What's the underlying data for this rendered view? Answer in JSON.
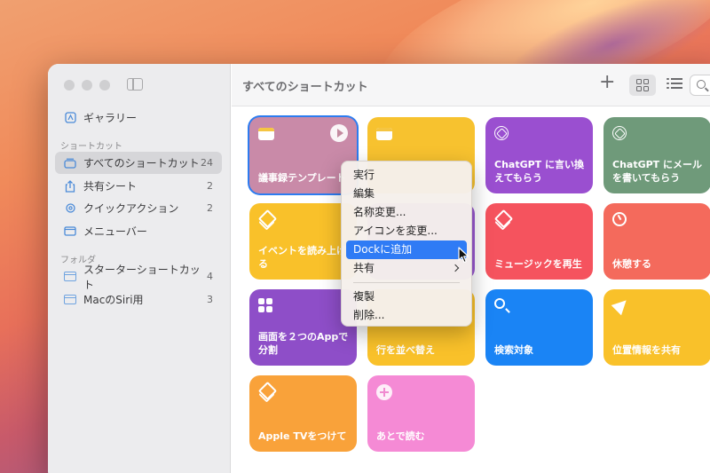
{
  "window": {
    "title": "すべてのショートカット"
  },
  "sidebar": {
    "gallery": {
      "label": "ギャラリー"
    },
    "shortcuts_section": "ショートカット",
    "items": [
      {
        "label": "すべてのショートカット",
        "count": "24",
        "icon": "stack-icon"
      },
      {
        "label": "共有シート",
        "count": "2",
        "icon": "share-icon"
      },
      {
        "label": "クイックアクション",
        "count": "2",
        "icon": "gear-icon"
      },
      {
        "label": "メニューバー",
        "count": "",
        "icon": "menubar-icon"
      }
    ],
    "folders_section": "フォルダ",
    "folders": [
      {
        "label": "スターターショートカット",
        "count": "4"
      },
      {
        "label": "MacのSiri用",
        "count": "3"
      }
    ]
  },
  "tiles": [
    {
      "name": "議事録テンプレート",
      "color": "#c98aa8",
      "icon": "note-icon"
    },
    {
      "name": "",
      "color": "#f7c22f",
      "icon": "note-icon"
    },
    {
      "name": "ChatGPT に言い換えてもらう",
      "color": "#9a4fd0",
      "icon": "openai-icon"
    },
    {
      "name": "ChatGPT にメールを書いてもらう",
      "color": "#6f9a7a",
      "icon": "openai-icon"
    },
    {
      "name": "イベントを読み上げる",
      "color": "#f9c12a",
      "icon": "layers-icon"
    },
    {
      "name": "",
      "color": "#9a5ad0",
      "icon": "layers-icon"
    },
    {
      "name": "ミュージックを再生",
      "color": "#f5535e",
      "icon": "layers-icon"
    },
    {
      "name": "休憩する",
      "color": "#f46a5c",
      "icon": "timer-icon"
    },
    {
      "name": "画面を２つのAppで分割",
      "color": "#8e4ec8",
      "icon": "grid-icon"
    },
    {
      "name": "行を並べ替え",
      "color": "#f9c12a",
      "icon": "none"
    },
    {
      "name": "検索対象",
      "color": "#1a84f5",
      "icon": "search-icon"
    },
    {
      "name": "位置情報を共有",
      "color": "#f9c12a",
      "icon": "location-icon"
    },
    {
      "name": "Apple TVをつけて",
      "color": "#f9a23a",
      "icon": "layers-icon"
    },
    {
      "name": "あとで読む",
      "color": "#f58ad5",
      "icon": "plus-icon"
    }
  ],
  "context_menu": {
    "items": [
      "実行",
      "編集",
      "名称変更...",
      "アイコンを変更...",
      "Dockに追加",
      "共有"
    ],
    "items2": [
      "複製",
      "削除..."
    ],
    "highlighted": "Dockに追加"
  }
}
